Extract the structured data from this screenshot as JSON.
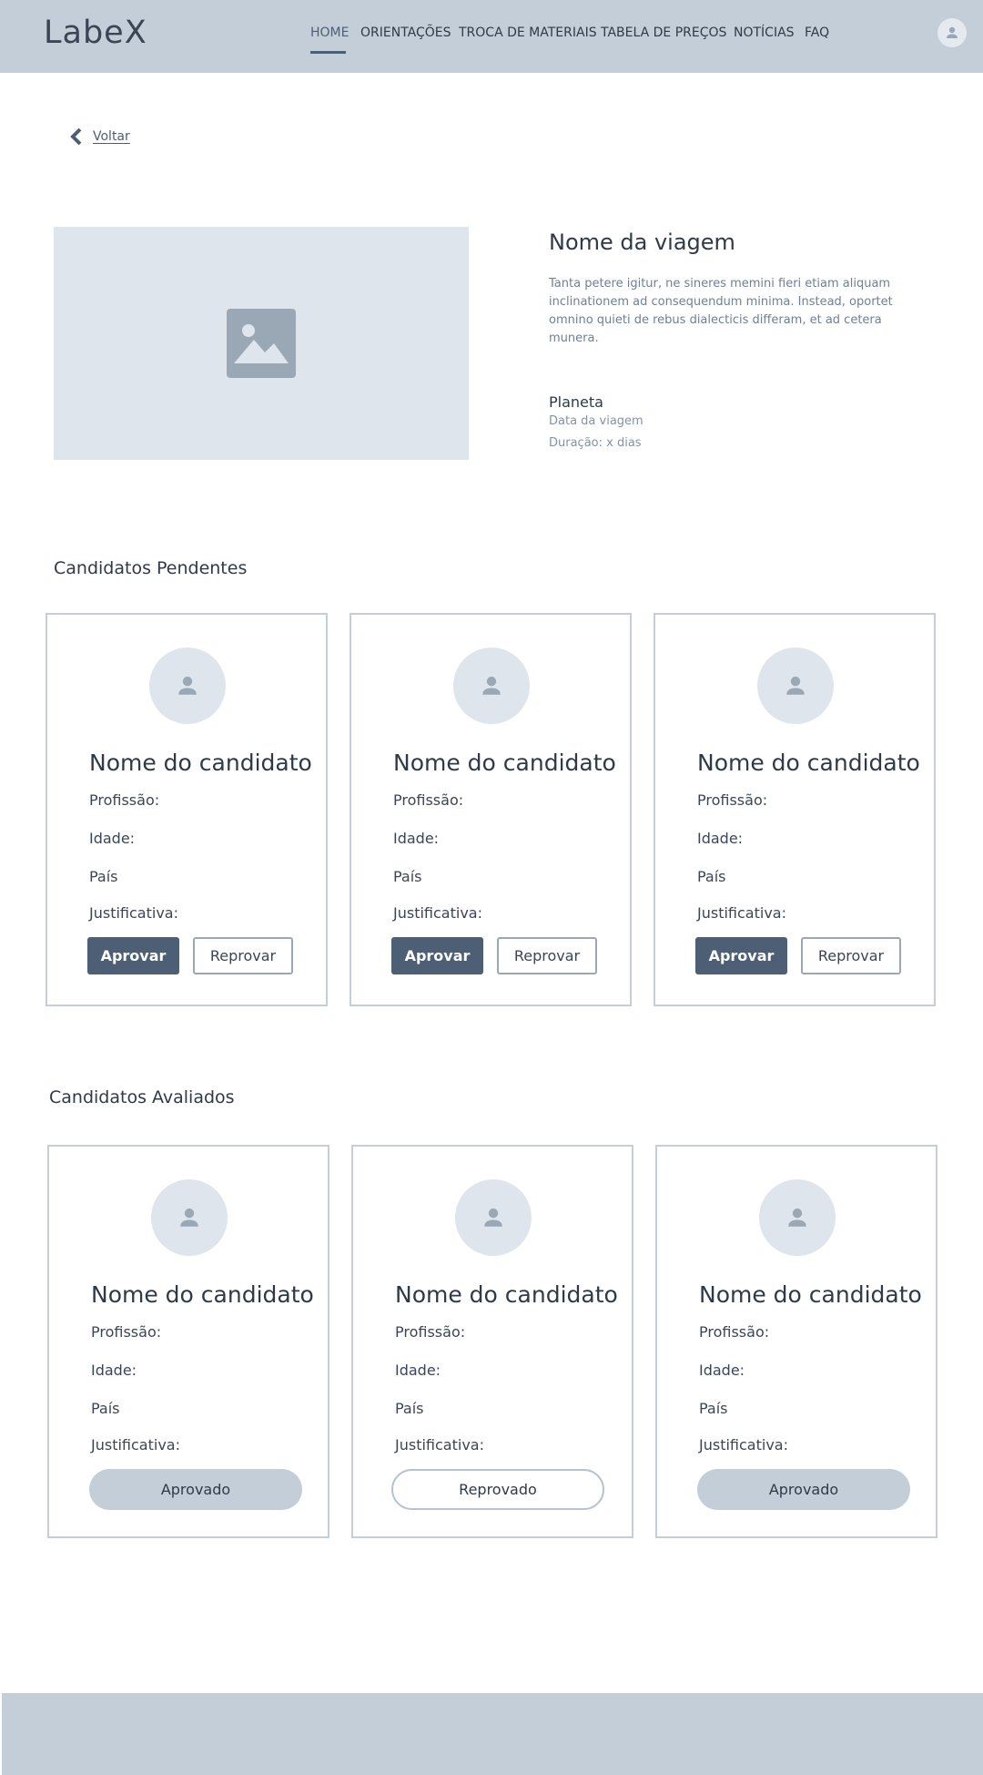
{
  "header": {
    "logo": "LabeX",
    "nav": [
      "HOME",
      "ORIENTAÇÕES",
      "TROCA DE MATERIAIS",
      "TABELA DE PREÇOS",
      "NOTÍCIAS",
      "FAQ"
    ],
    "active_nav": "HOME",
    "user_icon": "user-avatar-icon"
  },
  "back": {
    "label": "Voltar",
    "icon": "chevron-left-icon"
  },
  "trip": {
    "image_icon": "image-placeholder-icon",
    "title": "Nome da viagem",
    "description": "Tanta petere igitur, ne sineres memini fieri etiam aliquam inclinationem ad consequendum minima. Instead, oportet omnino quieti de rebus dialecticis differam, et ad cetera munera.",
    "planet": "Planeta",
    "date": "Data da viagem",
    "duration": "Duração: x dias"
  },
  "pending": {
    "title": "Candidatos Pendentes",
    "cards": [
      {
        "name": "Nome do candidato",
        "profession": "Profissão:",
        "age": "Idade:",
        "country": "País",
        "justification": "Justificativa:",
        "approve": "Aprovar",
        "reject": "Reprovar"
      },
      {
        "name": "Nome do candidato",
        "profession": "Profissão:",
        "age": "Idade:",
        "country": "País",
        "justification": "Justificativa:",
        "approve": "Aprovar",
        "reject": "Reprovar"
      },
      {
        "name": "Nome do candidato",
        "profession": "Profissão:",
        "age": "Idade:",
        "country": "País",
        "justification": "Justificativa:",
        "approve": "Aprovar",
        "reject": "Reprovar"
      }
    ]
  },
  "evaluated": {
    "title": "Candidatos Avaliados",
    "cards": [
      {
        "name": "Nome do candidato",
        "profession": "Profissão:",
        "age": "Idade:",
        "country": "País",
        "justification": "Justificativa:",
        "status": "Aprovado"
      },
      {
        "name": "Nome do candidato",
        "profession": "Profissão:",
        "age": "Idade:",
        "country": "País",
        "justification": "Justificativa:",
        "status": "Reprovado"
      },
      {
        "name": "Nome do candidato",
        "profession": "Profissão:",
        "age": "Idade:",
        "country": "País",
        "justification": "Justificativa:",
        "status": "Aprovado"
      }
    ]
  },
  "colors": {
    "header_bg": "#c3ced8",
    "primary": "#4c5f75",
    "placeholder": "#dfe5ec",
    "card_border": "#c3ced8"
  }
}
